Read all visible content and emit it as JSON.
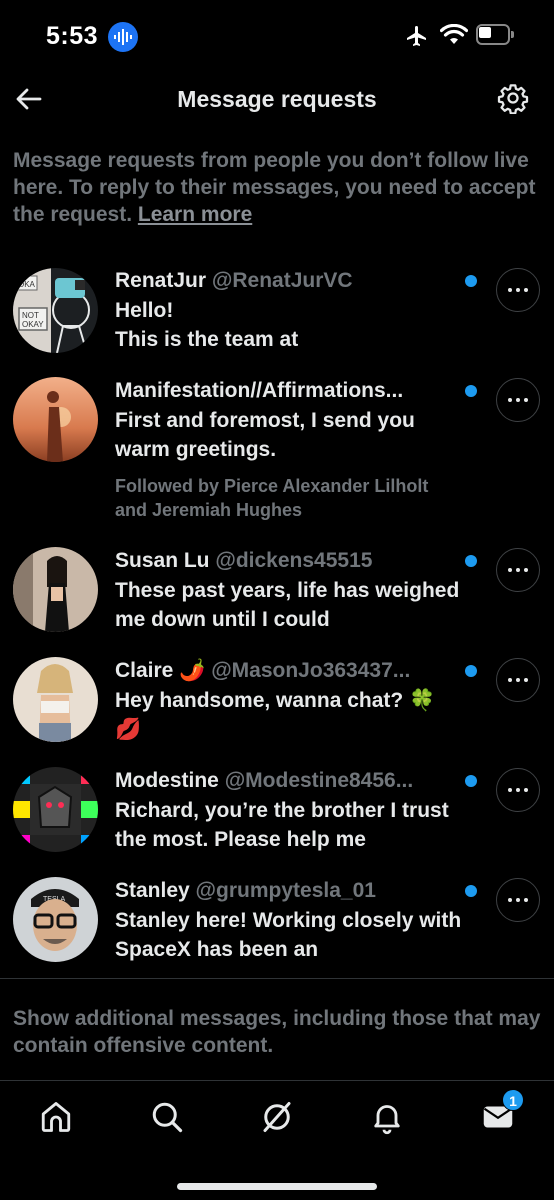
{
  "status_bar": {
    "time": "5:53"
  },
  "header": {
    "title": "Message requests"
  },
  "intro": {
    "text": "Message requests from people you don’t follow live here. To reply to their messages, you need to accept the request. ",
    "learn_more": "Learn more"
  },
  "requests": [
    {
      "name": "RenatJur",
      "handle": "@RenatJurVC",
      "preview": "Hello!\nThis is the team at",
      "followed_by": "",
      "unread": true,
      "avatar_icon": "okay-not-okay-avatar"
    },
    {
      "name": "Manifestation//Affirmations...",
      "handle": "",
      "preview": "First and foremost, I send you warm greetings.",
      "followed_by": "Followed by Pierce Alexander Lilholt and Jeremiah Hughes",
      "unread": true,
      "avatar_icon": "silhouette-avatar"
    },
    {
      "name": "Susan Lu",
      "handle": "@dickens45515",
      "preview": "These past years, life has weighed me down until I could",
      "followed_by": "",
      "unread": true,
      "avatar_icon": "woman-photo-avatar"
    },
    {
      "name": "Claire 🌶️",
      "handle": "@MasonJo363437...",
      "preview": "Hey handsome, wanna chat?  🍀 💋",
      "followed_by": "",
      "unread": true,
      "avatar_icon": "woman-photo-avatar"
    },
    {
      "name": "Modestine",
      "handle": "@Modestine8456...",
      "preview": "Richard, you’re the brother I trust the most. Please help me",
      "followed_by": "",
      "unread": true,
      "avatar_icon": "colorful-art-avatar"
    },
    {
      "name": "Stanley",
      "handle": "@grumpytesla_01",
      "preview": "Stanley here! Working closely with SpaceX has been an",
      "followed_by": "",
      "unread": true,
      "avatar_icon": "man-glasses-avatar"
    }
  ],
  "show_more": "Show additional messages, including those that may contain offensive content.",
  "nav": {
    "items": [
      "home-icon",
      "search-icon",
      "grok-icon",
      "notifications-icon",
      "messages-icon"
    ],
    "messages_badge": "1"
  },
  "colors": {
    "accent": "#1d9bf0",
    "muted": "#71767b",
    "text": "#e7e9ea",
    "background": "#000000"
  }
}
